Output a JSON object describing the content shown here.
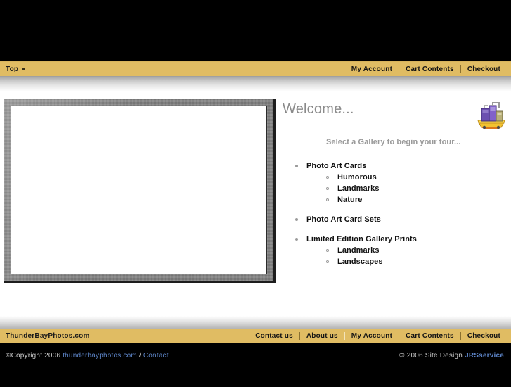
{
  "header": {
    "banner_alt": "site-banner"
  },
  "topnav": {
    "breadcrumb": "Top",
    "links": [
      {
        "label": "My Account"
      },
      {
        "label": "Cart Contents"
      },
      {
        "label": "Checkout"
      }
    ]
  },
  "main": {
    "welcome_title": "Welcome...",
    "subtitle": "Select a Gallery to begin your tour...",
    "cart_icon_name": "shopping-cart-icon",
    "galleries": [
      {
        "label": "Photo Art Cards",
        "children": [
          {
            "label": "Humorous"
          },
          {
            "label": "Landmarks"
          },
          {
            "label": "Nature"
          }
        ]
      },
      {
        "label": "Photo Art Card Sets",
        "children": []
      },
      {
        "label": "Limited Edition Gallery Prints",
        "children": [
          {
            "label": "Landmarks"
          },
          {
            "label": "Landscapes"
          }
        ]
      }
    ]
  },
  "footernav": {
    "brand": "ThunderBayPhotos.com",
    "links": [
      {
        "label": "Contact us"
      },
      {
        "label": "About us"
      },
      {
        "label": "My Account"
      },
      {
        "label": "Cart Contents"
      },
      {
        "label": "Checkout"
      }
    ]
  },
  "copyright": {
    "prefix": "©Copyright 2006",
    "site_link": "thunderbayphotos.com",
    "separator": "/",
    "contact_link": "Contact",
    "design_prefix": "© 2006 Site Design",
    "design_link": "JRSservice"
  },
  "colors": {
    "gold": "#e0bc63",
    "black": "#000000",
    "link_blue": "#5b82c4",
    "muted_gray": "#8a8a8a"
  }
}
